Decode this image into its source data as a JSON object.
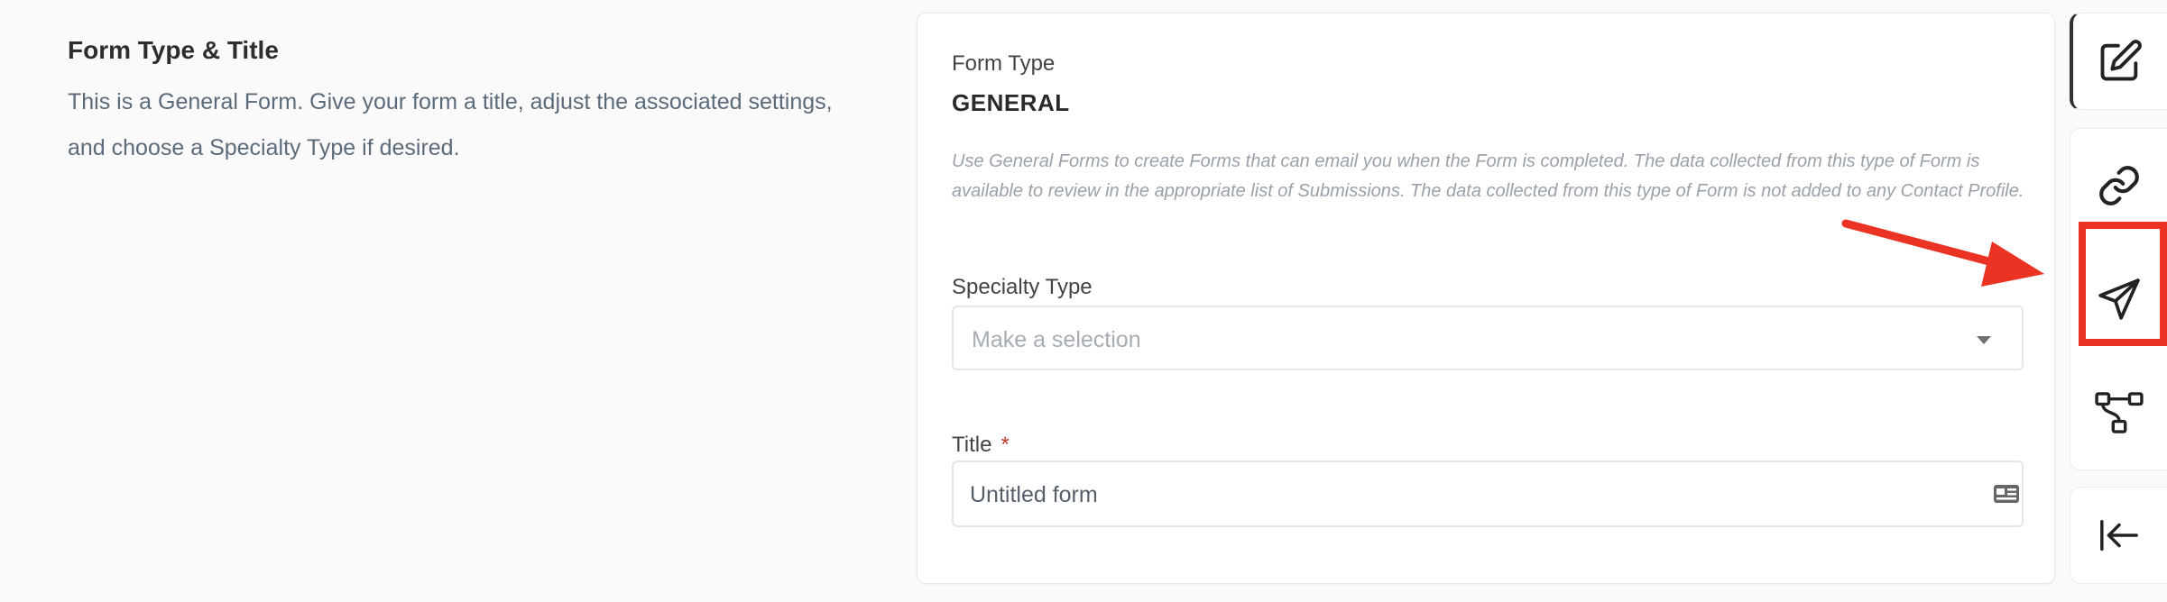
{
  "intro": {
    "heading": "Form Type & Title",
    "description": "This is a General Form. Give your form a title, adjust the associated settings, and choose a Specialty Type if desired."
  },
  "card": {
    "form_type_label": "Form Type",
    "form_type_value": "GENERAL",
    "help_text": "Use General Forms to create Forms that can email you when the Form is completed. The data collected from this type of Form is available to review in the appropriate list of Submissions. The data collected from this type of Form is not added to any Contact Profile.",
    "specialty_label": "Specialty Type",
    "specialty_placeholder": "Make a selection",
    "title_label": "Title",
    "title_required_mark": "*",
    "title_value": "Untitled form"
  },
  "rail": {
    "items": [
      {
        "icon": "edit-icon",
        "active": true
      },
      {
        "icon": "link-icon",
        "active": false
      },
      {
        "icon": "send-icon",
        "active": false,
        "highlighted": true
      },
      {
        "icon": "workflow-icon",
        "active": false
      },
      {
        "icon": "collapse-left-icon",
        "active": false
      }
    ]
  },
  "colors": {
    "annotation": "#ea3323",
    "required": "#c0392b",
    "muted_text": "#9aa1a8"
  }
}
